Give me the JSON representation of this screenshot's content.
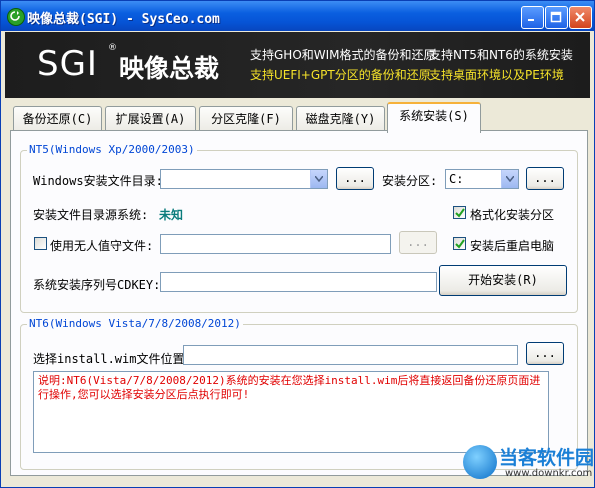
{
  "window": {
    "title": "映像总裁(SGI) - SysCeo.com"
  },
  "banner": {
    "logo_text": "SGI",
    "logo_reg": "®",
    "logo_cn": "映像总裁",
    "features": [
      "支持GHO和WIM格式的备份和还原",
      "支持NT5和NT6的系统安装",
      "支持UEFI+GPT分区的备份和还原",
      "支持桌面环境以及PE环境"
    ]
  },
  "tabs": [
    {
      "label": "备份还原(C)"
    },
    {
      "label": "扩展设置(A)"
    },
    {
      "label": "分区克隆(F)"
    },
    {
      "label": "磁盘克隆(Y)"
    },
    {
      "label": "系统安装(S)",
      "active": true
    }
  ],
  "nt5": {
    "legend": "NT5(Windows Xp/2000/2003)",
    "install_dir_label": "Windows安装文件目录:",
    "install_dir_value": "",
    "browse_label": "...",
    "partition_label": "安装分区:",
    "partition_value": "C:",
    "partition_browse_label": "...",
    "source_system_label": "安装文件目录源系统:",
    "source_system_value": "未知",
    "format_partition_label": "格式化安装分区",
    "format_partition_checked": true,
    "unattended_label": "使用无人值守文件:",
    "unattended_checked": false,
    "unattended_value": "",
    "unattended_browse_label": "...",
    "reboot_label": "安装后重启电脑",
    "reboot_checked": true,
    "cdkey_label": "系统安装序列号CDKEY:",
    "cdkey_value": "",
    "start_button": "开始安装(R)"
  },
  "nt6": {
    "legend": "NT6(Windows Vista/7/8/2008/2012)",
    "wim_label": "选择install.wim文件位置:",
    "wim_value": "",
    "browse_label": "...",
    "note": "说明:NT6(Vista/7/8/2008/2012)系统的安装在您选择install.wim后将直接返回备份还原页面进行操作,您可以选择安装分区后点执行即可!"
  },
  "watermark": {
    "name": "当客软件园",
    "url": "www.downkr.com"
  },
  "colors": {
    "titlebar": "#0654d6",
    "legend": "#0046d5",
    "note_text": "#e00000",
    "highlight": "#f5e22a"
  }
}
